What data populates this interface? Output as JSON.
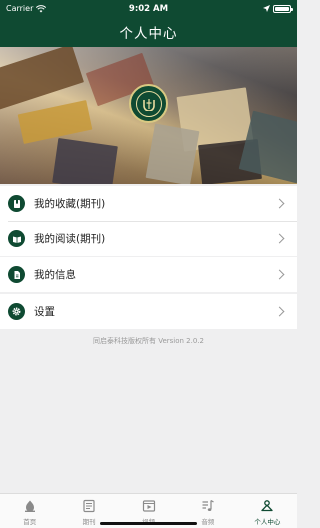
{
  "statusbar": {
    "carrier": "Carrier",
    "time": "9:02 AM"
  },
  "navbar": {
    "title": "个人中心"
  },
  "menu": [
    {
      "label": "我的收藏(期刊)",
      "icon": "bookmark-book-icon"
    },
    {
      "label": "我的阅读(期刊)",
      "icon": "open-book-icon"
    },
    {
      "label": "我的信息",
      "icon": "document-icon"
    },
    {
      "label": "设置",
      "icon": "gear-icon"
    }
  ],
  "copyright": "同启泰科技版权所有 Version 2.0.2",
  "tabs": [
    {
      "label": "首页",
      "icon": "home-icon",
      "active": false
    },
    {
      "label": "期刊",
      "icon": "journal-icon",
      "active": false
    },
    {
      "label": "视频",
      "icon": "video-icon",
      "active": false
    },
    {
      "label": "音频",
      "icon": "audio-icon",
      "active": false
    },
    {
      "label": "个人中心",
      "icon": "profile-icon",
      "active": true
    }
  ],
  "colors": {
    "primary": "#0f4a32",
    "background": "#efeff0",
    "tab_inactive": "#8a8a8a"
  }
}
